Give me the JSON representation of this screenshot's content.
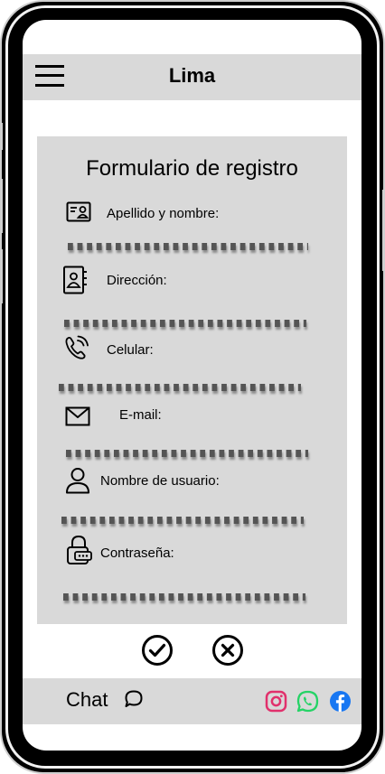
{
  "header": {
    "title": "Lima"
  },
  "form": {
    "title": "Formulario de registro",
    "fields": [
      {
        "label": "Apellido y nombre:",
        "icon": "contact-card-icon",
        "value": ""
      },
      {
        "label": "Dirección:",
        "icon": "address-book-icon",
        "value": ""
      },
      {
        "label": "Celular:",
        "icon": "phone-icon",
        "value": ""
      },
      {
        "label": "E-mail:",
        "icon": "mail-icon",
        "value": ""
      },
      {
        "label": "Nombre de usuario:",
        "icon": "user-icon",
        "value": ""
      },
      {
        "label": "Contraseña:",
        "icon": "lock-icon",
        "value": ""
      }
    ]
  },
  "actions": {
    "confirm_icon": "check-circle-icon",
    "cancel_icon": "x-circle-icon"
  },
  "footer": {
    "chat_label": "Chat",
    "chat_icon": "chat-bubble-icon",
    "social": [
      {
        "name": "instagram-icon",
        "color": "#e1306c"
      },
      {
        "name": "whatsapp-icon",
        "color": "#25d366"
      },
      {
        "name": "facebook-icon",
        "color": "#1877f2"
      }
    ]
  },
  "colors": {
    "panel": "#d9d9d9",
    "frame": "#000000",
    "dots": "#555555"
  }
}
